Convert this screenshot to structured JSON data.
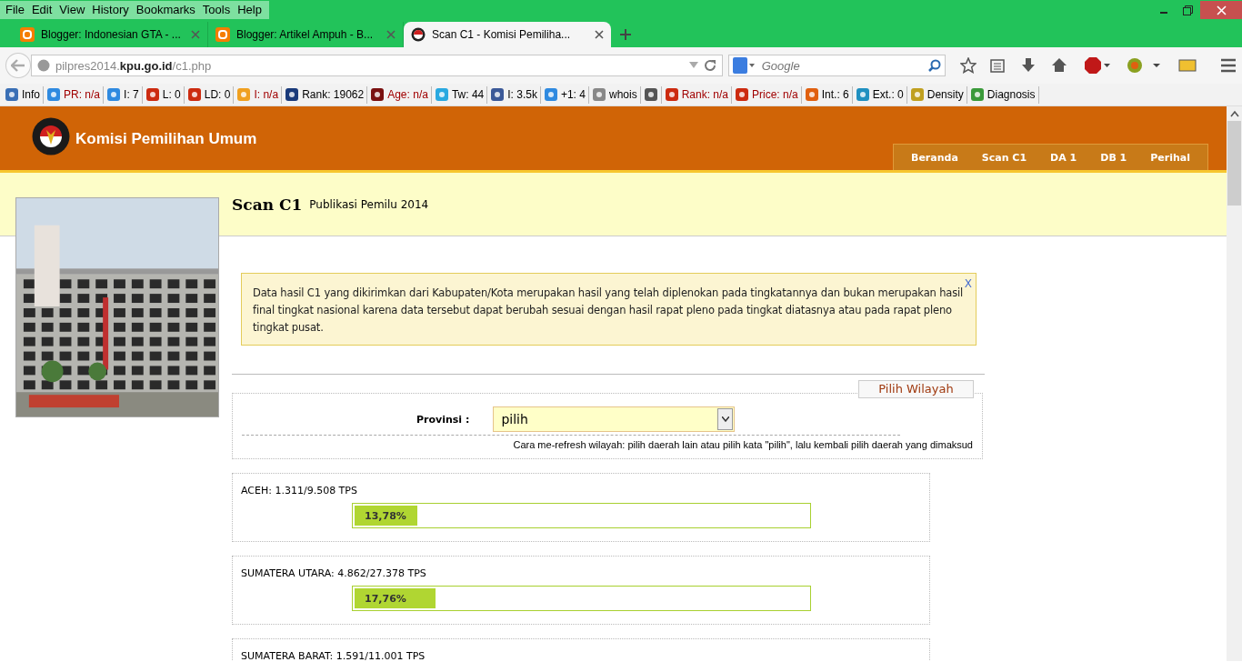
{
  "menu_bar": [
    "File",
    "Edit",
    "View",
    "History",
    "Bookmarks",
    "Tools",
    "Help"
  ],
  "tabs": [
    {
      "label": "Blogger: Indonesian GTA - ...",
      "selected": false
    },
    {
      "label": "Blogger: Artikel Ampuh - B...",
      "selected": false
    },
    {
      "label": "Scan C1 - Komisi Pemiliha...",
      "selected": true
    }
  ],
  "address_bar": {
    "value": "pilpres2014.**kpu.go.id**/c1.php"
  },
  "search": {
    "placeholder": "Google"
  },
  "seo_toolbar": [
    {
      "text": "Info",
      "color": "#000000"
    },
    {
      "text": "PR: n/a",
      "color": "#a00000"
    },
    {
      "text": "I: 7",
      "color": "#000000"
    },
    {
      "text": "L: 0",
      "color": "#000000"
    },
    {
      "text": "LD: 0",
      "color": "#000000"
    },
    {
      "text": "I: n/a",
      "color": "#a00000"
    },
    {
      "text": "Rank: 19062",
      "color": "#000000"
    },
    {
      "text": "Age: n/a",
      "color": "#a00000"
    },
    {
      "text": "Tw: 44",
      "color": "#000000"
    },
    {
      "text": "I: 3.5k",
      "color": "#000000"
    },
    {
      "text": "+1: 4",
      "color": "#000000"
    },
    {
      "text": "whois",
      "color": "#000000"
    },
    {
      "kind": "icon"
    },
    {
      "text": "Rank: n/a",
      "color": "#a00000"
    },
    {
      "text": "Price: n/a",
      "color": "#a00000"
    },
    {
      "text": "Int.: 6",
      "color": "#000000"
    },
    {
      "text": "Ext.: 0",
      "color": "#000000"
    },
    {
      "text": "Density",
      "color": "#000000"
    },
    {
      "text": "Diagnosis",
      "color": "#000000"
    }
  ],
  "site": {
    "title": "Komisi Pemilihan Umum",
    "nav": [
      "Beranda",
      "Scan C1",
      "DA 1",
      "DB 1",
      "Perihal"
    ]
  },
  "page_heading": {
    "title": "Scan C1",
    "subtitle": "Publikasi Pemilu 2014"
  },
  "notice": {
    "text": "Data hasil C1 yang dikirimkan dari Kabupaten/Kota merupakan hasil yang telah diplenokan pada tingkatannya dan bukan merupakan hasil final tingkat nasional karena data tersebut dapat berubah sesuai dengan hasil rapat pleno pada tingkat diatasnya atau pada rapat pleno tingkat pusat.",
    "close": "X"
  },
  "region_picker": {
    "title": "Pilih Wilayah",
    "label": "Provinsi :",
    "value": "pilih",
    "hint": "Cara me-refresh wilayah: pilih daerah lain atau pilih kata \"pilih\", lalu kembali pilih daerah yang dimaksud"
  },
  "provinces": [
    {
      "label": "ACEH: 1.311/9.508 TPS",
      "level": 0.1378,
      "percent": "13,78%"
    },
    {
      "label": "SUMATERA UTARA: 4.862/27.378 TPS",
      "level": 0.1776,
      "percent": "17,76%"
    },
    {
      "label": "SUMATERA BARAT: 1.591/11.001 TPS"
    }
  ]
}
